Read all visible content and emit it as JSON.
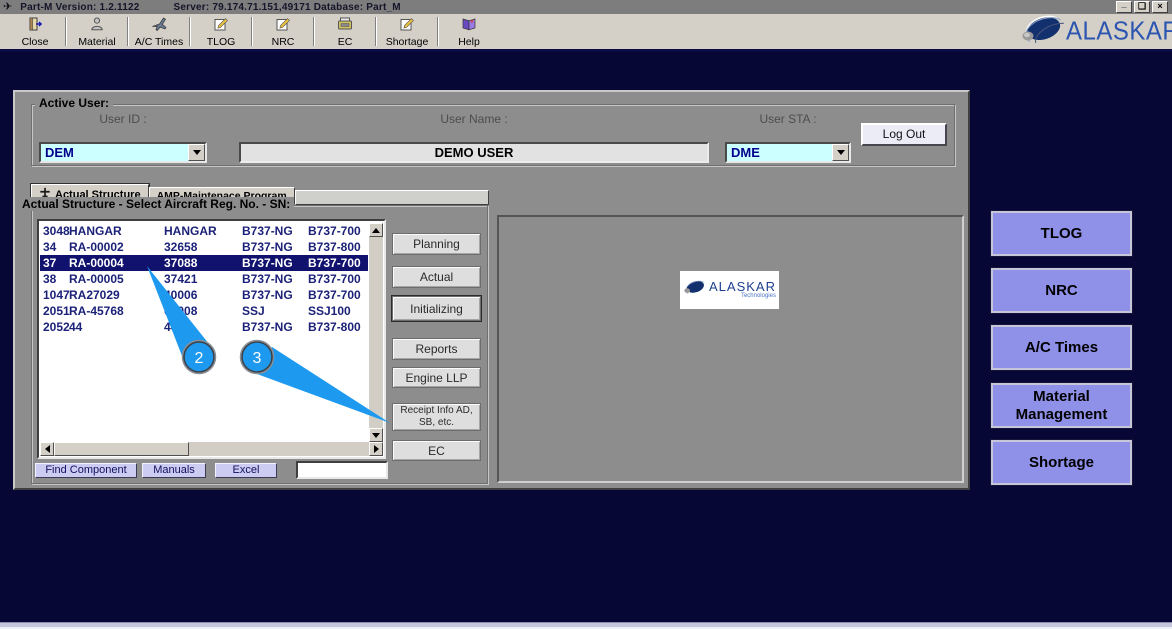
{
  "window": {
    "title_product": "Part-M Version: 1.2.1122",
    "title_server": "Server: 79.174.71.151,49171 Database: Part_M",
    "plane_glyph": "✈",
    "minimize_glyph": "_",
    "restore_glyph": "❏",
    "close_glyph": "×"
  },
  "toolbar": {
    "buttons": [
      {
        "label": "Close",
        "icon": "exit-door-icon"
      },
      {
        "label": "Material",
        "icon": "person-icon"
      },
      {
        "label": "A/C Times",
        "icon": "airplane-icon"
      },
      {
        "label": "TLOG",
        "icon": "note-pencil-icon"
      },
      {
        "label": "NRC",
        "icon": "note-pencil-icon"
      },
      {
        "label": "EC",
        "icon": "printer-icon"
      },
      {
        "label": "Shortage",
        "icon": "note-pencil-icon"
      },
      {
        "label": "Help",
        "icon": "book-icon"
      }
    ]
  },
  "brand": {
    "name": "ALASKAR",
    "subtitle": "Technologies"
  },
  "active_user": {
    "group_label": "Active User:",
    "user_id_label": "User ID :",
    "user_id_value": "DEM",
    "user_name_label": "User Name :",
    "user_name_value": "DEMO USER",
    "user_sta_label": "User STA :",
    "user_sta_value": "DME",
    "logout_label": "Log Out"
  },
  "tabs": {
    "tab1": "Actual Structure",
    "tab2": "AMP-Maintenace Program"
  },
  "aircraft": {
    "group_label": "Actual Structure - Select Aircraft Reg. No. - SN:",
    "rows": [
      [
        "3048",
        "HANGAR",
        "HANGAR",
        "B737-NG",
        "B737-700"
      ],
      [
        "34",
        "RA-00002",
        "32658",
        "B737-NG",
        "B737-800"
      ],
      [
        "37",
        "RA-00004",
        "37088",
        "B737-NG",
        "B737-700"
      ],
      [
        "38",
        "RA-00005",
        "37421",
        "B737-NG",
        "B737-700"
      ],
      [
        "1047",
        "RA27029",
        "40006",
        "B737-NG",
        "B737-700"
      ],
      [
        "2051",
        "RA-45768",
        "05008",
        "SSJ",
        "SSJ100"
      ],
      [
        "2052",
        "44",
        "44",
        "B737-NG",
        "B737-800"
      ]
    ],
    "selected_row_index": 2,
    "find_component_label": "Find Component",
    "manuals_label": "Manuals",
    "excel_label": "Excel",
    "filter_value": ""
  },
  "actions": [
    "Planning",
    "Actual",
    "Initializing",
    "Reports",
    "Engine LLP",
    "Receipt Info AD, SB, etc.",
    "EC"
  ],
  "side_nav": [
    "TLOG",
    "NRC",
    "A/C Times",
    "Material Management",
    "Shortage"
  ],
  "callouts": {
    "step2_label": "2",
    "step3_label": "3"
  },
  "colors": {
    "callout_blue": "#1d9af0",
    "navy_background": "#070736",
    "selected_row": "#10126e",
    "list_text": "#1c2278",
    "field_cyan": "#ccffff",
    "nav_button_fill": "#8f90e8",
    "panel_gray": "#8d8d8d",
    "toolbar_gray": "#d4d0c8"
  }
}
